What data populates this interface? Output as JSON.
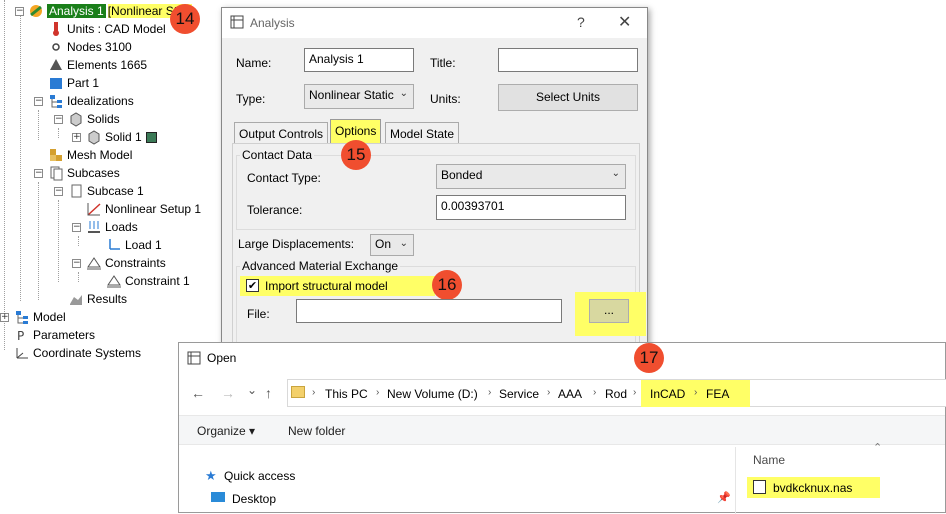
{
  "tree": {
    "analysis_label": "Analysis 1",
    "analysis_type": "[Nonlinear Sta",
    "units": "Units : CAD Model",
    "nodes": "Nodes 3100",
    "elements": "Elements 1665",
    "part": "Part 1",
    "idealizations": "Idealizations",
    "solids": "Solids",
    "solid1": "Solid 1",
    "mesh_model": "Mesh Model",
    "subcases": "Subcases",
    "subcase1": "Subcase 1",
    "nonlinear_setup": "Nonlinear Setup 1",
    "loads": "Loads",
    "load1": "Load 1",
    "constraints": "Constraints",
    "constraint1": "Constraint 1",
    "results": "Results",
    "model": "Model",
    "parameters": "Parameters",
    "coord_systems": "Coordinate Systems",
    "solid_color": "#3b7a57"
  },
  "badges": {
    "b14": "14",
    "b15": "15",
    "b16": "16",
    "b17": "17"
  },
  "analysis_dialog": {
    "title": "Analysis",
    "help": "?",
    "close": "✕",
    "name_label": "Name:",
    "name_value": "Analysis 1",
    "title_label": "Title:",
    "title_value": "",
    "type_label": "Type:",
    "type_value": "Nonlinear Static",
    "units_label": "Units:",
    "select_units": "Select Units",
    "tabs": [
      "Output Controls",
      "Options",
      "Model State"
    ],
    "contact_data": "Contact Data",
    "contact_type_label": "Contact Type:",
    "contact_type_value": "Bonded",
    "tolerance_label": "Tolerance:",
    "tolerance_value": "0.00393701",
    "large_disp_label": "Large Displacements:",
    "large_disp_value": "On",
    "adv_mat_exchange": "Advanced Material Exchange",
    "import_label": "Import structural model",
    "import_checked": "✔",
    "file_label": "File:",
    "file_value": "",
    "browse": "..."
  },
  "open_dialog": {
    "title": "Open",
    "back": "←",
    "forward": "→",
    "recent": "⌄",
    "up": "↑",
    "path": [
      "This PC",
      "New Volume (D:)",
      "Service",
      "AAA",
      "Rod",
      "InCAD",
      "FEA"
    ],
    "organize": "Organize ▾",
    "new_folder": "New folder",
    "quick_access": "Quick access",
    "desktop": "Desktop",
    "col_name": "Name",
    "sort_up": "⌃",
    "file": "bvdkcknux.nas"
  },
  "colors": {
    "highlight": "#ffff66",
    "badge": "#f04e2f",
    "selected": "#1a7f1a"
  }
}
